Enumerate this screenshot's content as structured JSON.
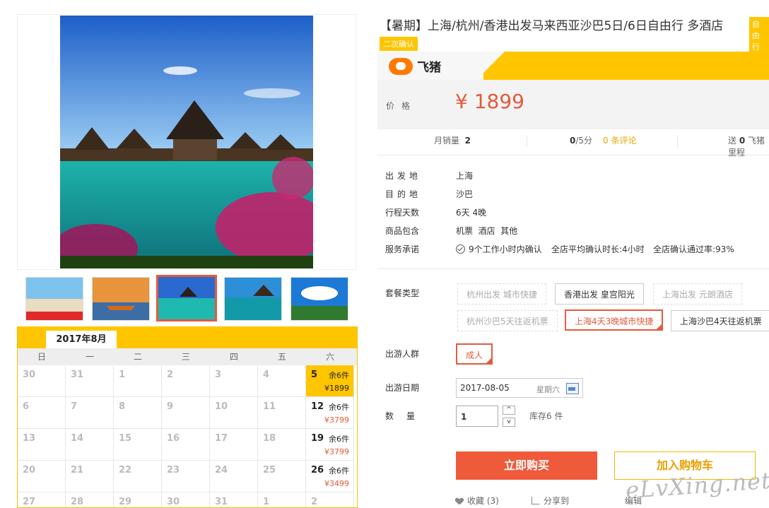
{
  "product": {
    "title": "【暑期】上海/杭州/香港出发马来西亚沙巴5日/6日自由行 多酒店",
    "tag_free": "自由行",
    "tag_confirm": "二次确认",
    "brand_name": "飞猪",
    "price_label": "价格",
    "price": "¥ 1899"
  },
  "stats": {
    "monthly_sales_label": "月销量",
    "monthly_sales": "2",
    "rating": "0",
    "rating_suffix": "/5分",
    "reviews": "0 条评论",
    "mileage_prefix": "送",
    "mileage_value": "0",
    "mileage_suffix": "飞猪里程"
  },
  "info": [
    {
      "label": "出发地",
      "value": "上海"
    },
    {
      "label": "目的地",
      "value": "沙巴"
    },
    {
      "label": "行程天数",
      "value": "6天 4晚"
    },
    {
      "label": "商品包含",
      "value": "机票  酒店  其他"
    }
  ],
  "promise": {
    "label": "服务承诺",
    "item1": "9个工作小时内确认",
    "item2": "全店平均确认时长:4小时",
    "item3": "全店确认通过率:93%"
  },
  "package": {
    "label": "套餐类型",
    "options": [
      "杭州出发 城市快捷",
      "香港出发 皇宫阳光",
      "上海出发 元朗酒店",
      "杭州沙巴5天往返机票",
      "上海4天3晚城市快捷",
      "上海沙巴4天往返机票"
    ]
  },
  "traveler": {
    "label": "出游人群",
    "value": "成人"
  },
  "date": {
    "label": "出游日期",
    "value": "2017-08-05",
    "weekday": "星期六"
  },
  "quantity": {
    "label": "数量",
    "value": "1",
    "up": "^",
    "down": "v",
    "stock": "库存6 件"
  },
  "buttons": {
    "buy": "立即购买",
    "cart": "加入购物车"
  },
  "bottom": {
    "favorite": "收藏 (3)",
    "share": "分享到",
    "edit": "编辑"
  },
  "watermark": "eLvXing.net",
  "calendar": {
    "month": "2017年8月",
    "weekdays": [
      "日",
      "一",
      "二",
      "三",
      "四",
      "五",
      "六"
    ],
    "weeks": [
      [
        {
          "d": "30"
        },
        {
          "d": "31"
        },
        {
          "d": "1"
        },
        {
          "d": "2"
        },
        {
          "d": "3"
        },
        {
          "d": "4"
        },
        {
          "d": "5",
          "stock": "余6件",
          "price": "¥1899",
          "selected": true
        }
      ],
      [
        {
          "d": "6"
        },
        {
          "d": "7"
        },
        {
          "d": "8"
        },
        {
          "d": "9"
        },
        {
          "d": "10"
        },
        {
          "d": "11"
        },
        {
          "d": "12",
          "stock": "余6件",
          "price": "¥3799"
        }
      ],
      [
        {
          "d": "13"
        },
        {
          "d": "14"
        },
        {
          "d": "15"
        },
        {
          "d": "16"
        },
        {
          "d": "17"
        },
        {
          "d": "18"
        },
        {
          "d": "19",
          "stock": "余6件",
          "price": "¥3799"
        }
      ],
      [
        {
          "d": "20"
        },
        {
          "d": "21"
        },
        {
          "d": "22"
        },
        {
          "d": "23"
        },
        {
          "d": "24"
        },
        {
          "d": "25"
        },
        {
          "d": "26",
          "stock": "余6件",
          "price": "¥3499"
        }
      ],
      [
        {
          "d": "27"
        },
        {
          "d": "28"
        },
        {
          "d": "29"
        },
        {
          "d": "30"
        },
        {
          "d": "31"
        },
        {
          "d": "1"
        },
        {
          "d": "2"
        }
      ]
    ]
  },
  "colors": {
    "accent": "#ffc600",
    "price": "#e45a3b",
    "buy": "#ef5a3b"
  }
}
